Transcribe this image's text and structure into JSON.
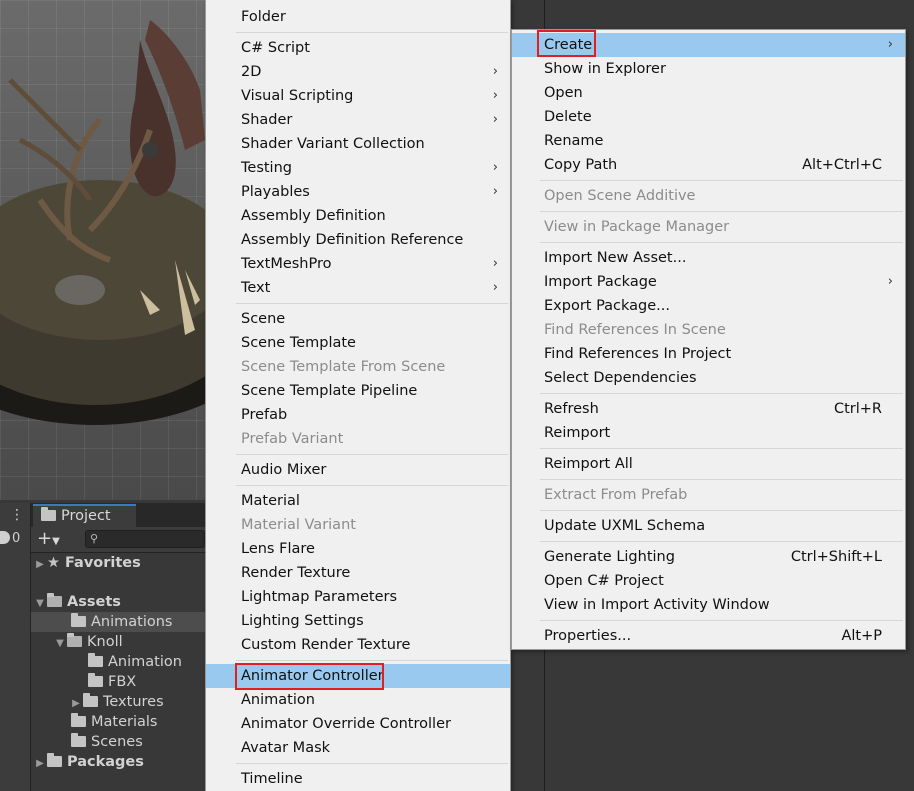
{
  "project_panel": {
    "tab_label": "Project",
    "badge_count": "0",
    "plus_label": "+",
    "tree": [
      {
        "label": "Favorites",
        "bold": true
      },
      {
        "label": "Assets",
        "bold": true
      },
      {
        "label": "Animations"
      },
      {
        "label": "Knoll"
      },
      {
        "label": "Animation"
      },
      {
        "label": "FBX"
      },
      {
        "label": "Textures"
      },
      {
        "label": "Materials"
      },
      {
        "label": "Scenes"
      },
      {
        "label": "Packages",
        "bold": true
      }
    ]
  },
  "create_menu": {
    "items": [
      {
        "label": "Folder"
      },
      {
        "label": "C# Script"
      },
      {
        "label": "2D",
        "submenu": true
      },
      {
        "label": "Visual Scripting",
        "submenu": true
      },
      {
        "label": "Shader",
        "submenu": true
      },
      {
        "label": "Shader Variant Collection"
      },
      {
        "label": "Testing",
        "submenu": true
      },
      {
        "label": "Playables",
        "submenu": true
      },
      {
        "label": "Assembly Definition"
      },
      {
        "label": "Assembly Definition Reference"
      },
      {
        "label": "TextMeshPro",
        "submenu": true
      },
      {
        "label": "Text",
        "submenu": true
      },
      {
        "label": "Scene"
      },
      {
        "label": "Scene Template"
      },
      {
        "label": "Scene Template From Scene",
        "disabled": true
      },
      {
        "label": "Scene Template Pipeline"
      },
      {
        "label": "Prefab"
      },
      {
        "label": "Prefab Variant",
        "disabled": true
      },
      {
        "label": "Audio Mixer"
      },
      {
        "label": "Material"
      },
      {
        "label": "Material Variant",
        "disabled": true
      },
      {
        "label": "Lens Flare"
      },
      {
        "label": "Render Texture"
      },
      {
        "label": "Lightmap Parameters"
      },
      {
        "label": "Lighting Settings"
      },
      {
        "label": "Custom Render Texture"
      },
      {
        "label": "Animator Controller",
        "highlighted": true
      },
      {
        "label": "Animation"
      },
      {
        "label": "Animator Override Controller"
      },
      {
        "label": "Avatar Mask"
      },
      {
        "label": "Timeline"
      }
    ]
  },
  "assets_menu": {
    "items": [
      {
        "label": "Create",
        "submenu": true,
        "highlighted": true
      },
      {
        "label": "Show in Explorer"
      },
      {
        "label": "Open"
      },
      {
        "label": "Delete"
      },
      {
        "label": "Rename"
      },
      {
        "label": "Copy Path",
        "shortcut": "Alt+Ctrl+C"
      },
      {
        "label": "Open Scene Additive",
        "disabled": true
      },
      {
        "label": "View in Package Manager",
        "disabled": true
      },
      {
        "label": "Import New Asset..."
      },
      {
        "label": "Import Package",
        "submenu": true
      },
      {
        "label": "Export Package..."
      },
      {
        "label": "Find References In Scene",
        "disabled": true
      },
      {
        "label": "Find References In Project"
      },
      {
        "label": "Select Dependencies"
      },
      {
        "label": "Refresh",
        "shortcut": "Ctrl+R"
      },
      {
        "label": "Reimport"
      },
      {
        "label": "Reimport All"
      },
      {
        "label": "Extract From Prefab",
        "disabled": true
      },
      {
        "label": "Update UXML Schema"
      },
      {
        "label": "Generate Lighting",
        "shortcut": "Ctrl+Shift+L"
      },
      {
        "label": "Open C# Project"
      },
      {
        "label": "View in Import Activity Window"
      },
      {
        "label": "Properties...",
        "shortcut": "Alt+P"
      }
    ]
  },
  "colors": {
    "highlight": "#99c9ef",
    "callout_border": "#e02020",
    "menu_bg": "#f0f0f0",
    "editor_bg": "#383838"
  }
}
